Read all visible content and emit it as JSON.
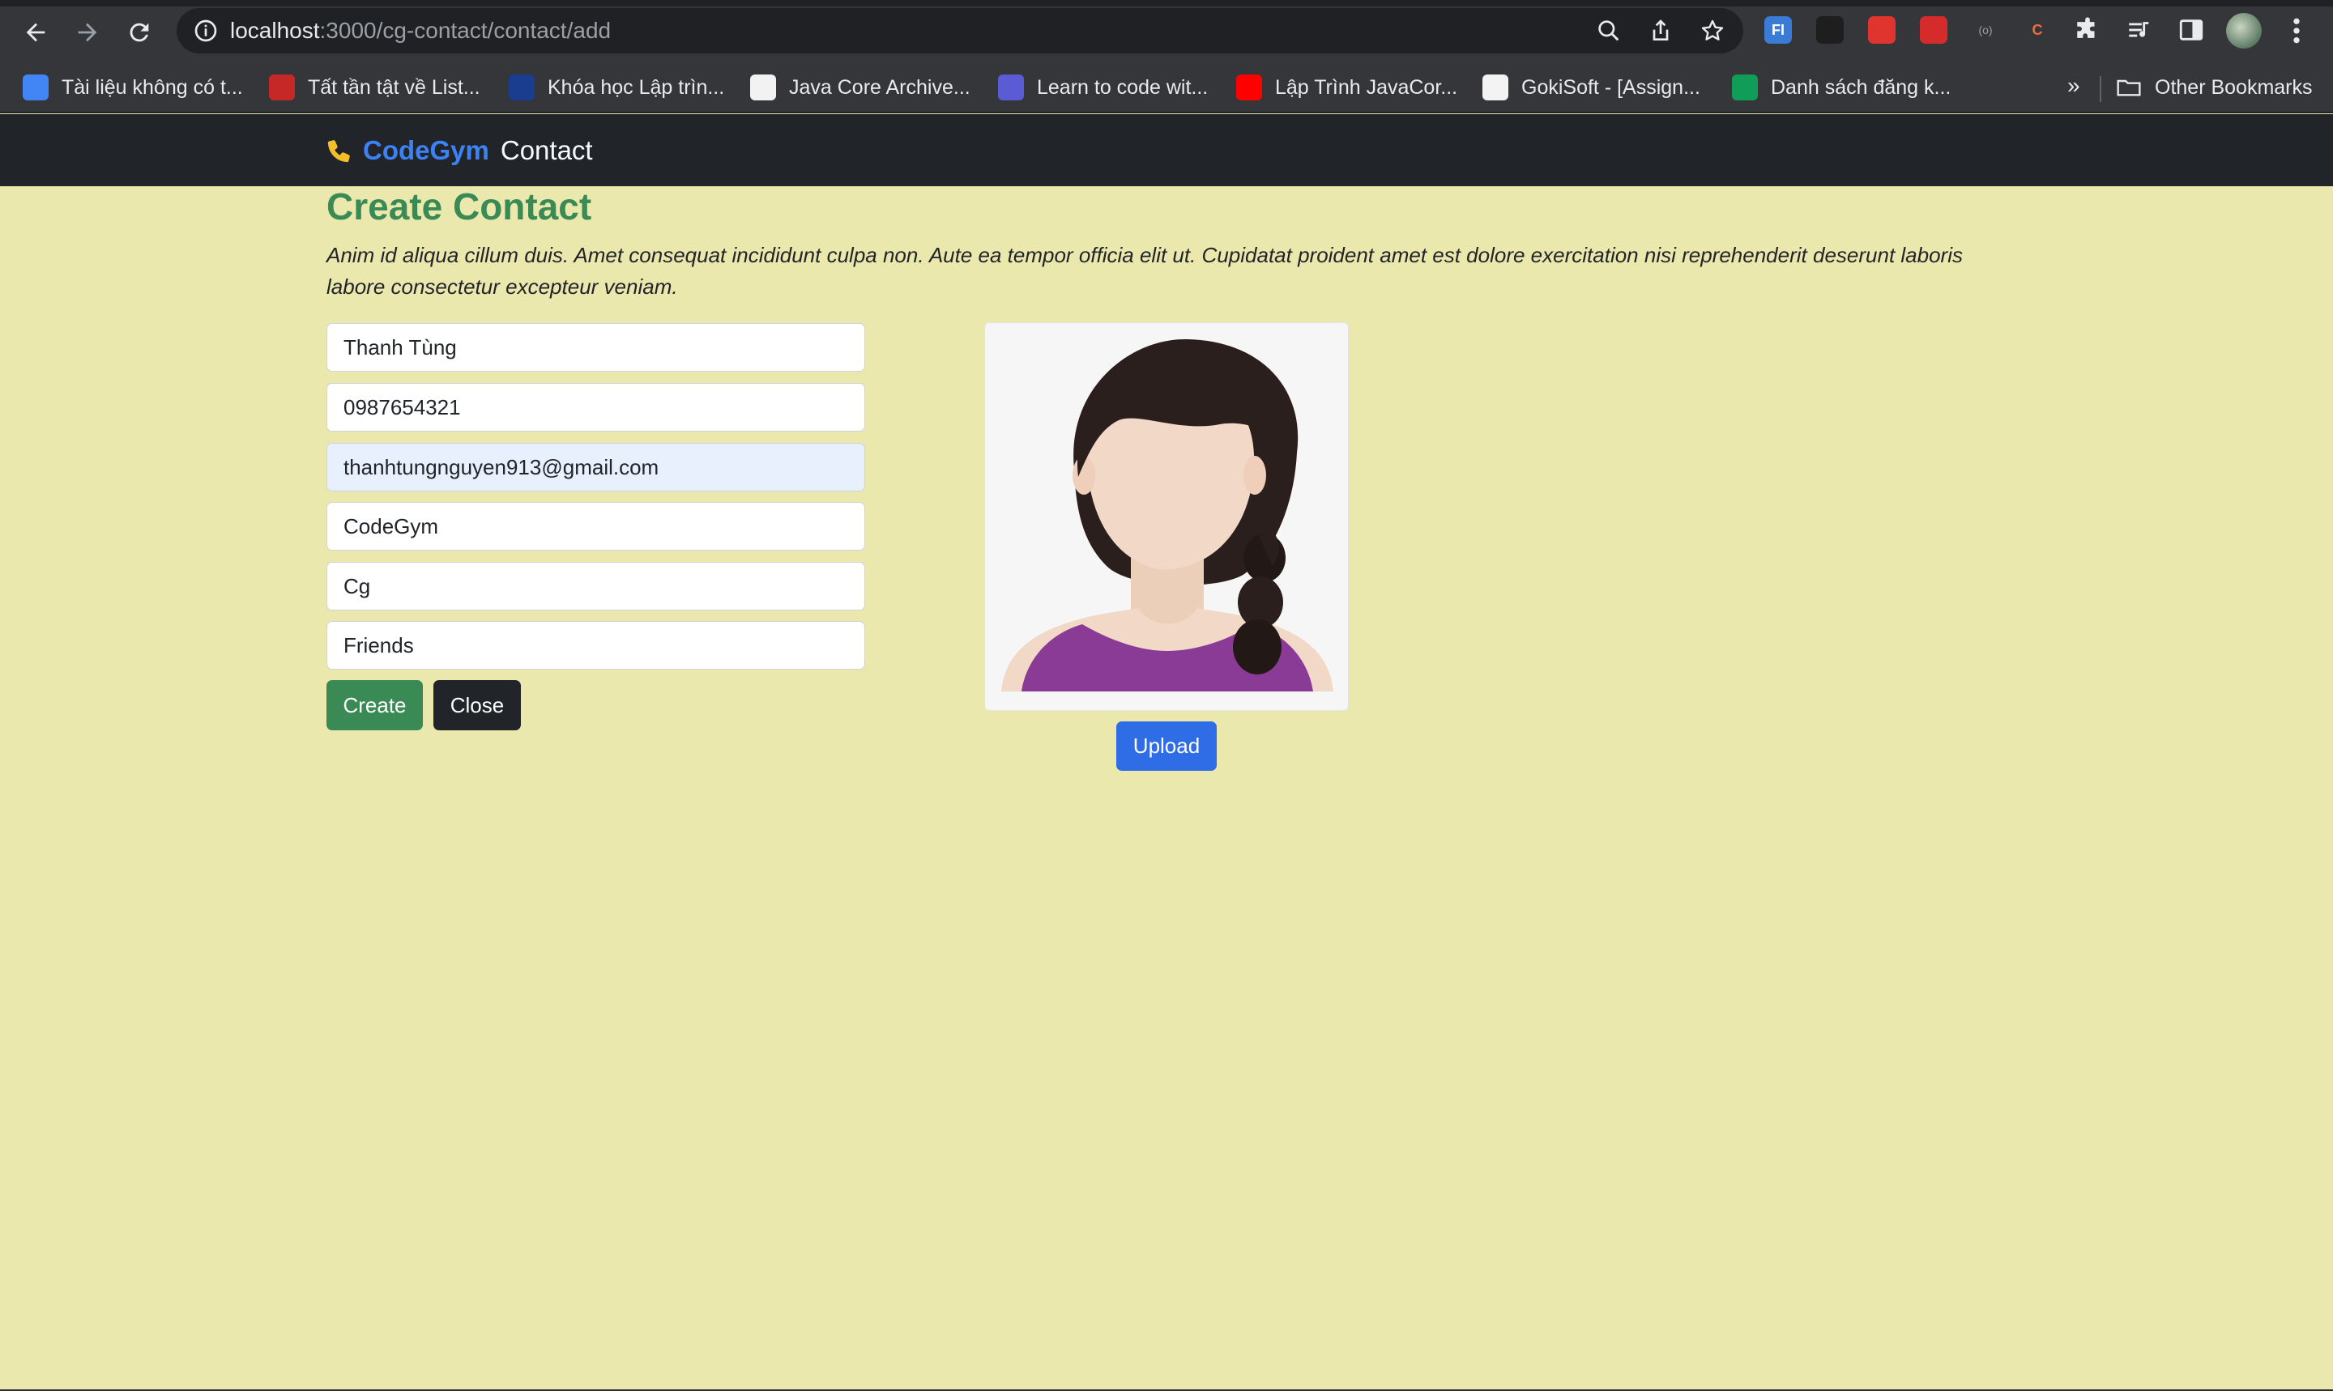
{
  "browser": {
    "url_host": "localhost",
    "url_path": ":3000/cg-contact/contact/add",
    "extensions": [
      {
        "name": "fi-extension-icon",
        "label": "FI",
        "color": "#3a7bd5"
      },
      {
        "name": "extension-2-icon",
        "label": "",
        "color": "#1e1e1e"
      },
      {
        "name": "extension-3-icon",
        "label": "",
        "color": "#e0342f"
      },
      {
        "name": "extension-4-icon",
        "label": "",
        "color": "#d62b2b"
      },
      {
        "name": "extension-5-icon",
        "label": "(o)",
        "color": "#35363a"
      },
      {
        "name": "extension-6-icon",
        "label": "C",
        "color": "#35363a"
      }
    ],
    "bookmarks": [
      {
        "label": "Tài liệu không có t...",
        "icon": "docs-icon",
        "color": "#4285f4"
      },
      {
        "label": "Tất tần tật về List...",
        "icon": "list-icon",
        "color": "#c62828"
      },
      {
        "label": "Khóa học Lập trìn...",
        "icon": "course-icon",
        "color": "#1a3d8f"
      },
      {
        "label": "Java Core Archive...",
        "icon": "java-icon",
        "color": "#f2f2f2"
      },
      {
        "label": "Learn to code wit...",
        "icon": "code-icon",
        "color": "#5b5bd6"
      },
      {
        "label": "Lập Trình JavaCor...",
        "icon": "youtube-icon",
        "color": "#ff0000"
      },
      {
        "label": "GokiSoft - [Assign...",
        "icon": "gokisoft-icon",
        "color": "#f3f3f3"
      },
      {
        "label": "Danh sách đăng k...",
        "icon": "sheets-icon",
        "color": "#0f9d58"
      }
    ],
    "more_bookmarks": "»",
    "other_bookmarks": "Other Bookmarks"
  },
  "navbar": {
    "brand": "CodeGym",
    "subtitle": "Contact",
    "brand_color": "#3d82f5",
    "phone_icon": "phone-icon"
  },
  "page": {
    "title": "Create Contact",
    "description": "Anim id aliqua cillum duis. Amet consequat incididunt culpa non. Aute ea tempor officia elit ut. Cupidatat proident amet est dolore exercitation nisi reprehenderit deserunt laboris labore consectetur excepteur veniam."
  },
  "form": {
    "name": "Thanh Tùng",
    "phone": "0987654321",
    "email": "thanhtungnguyen913@gmail.com",
    "company": "CodeGym",
    "short_name": "Cg",
    "group": "Friends",
    "create_label": "Create",
    "close_label": "Close"
  },
  "avatar": {
    "upload_label": "Upload"
  },
  "colors": {
    "page_bg": "#ebe8ae",
    "title": "#3a8a55",
    "create_btn": "#3a8a55",
    "close_btn": "#212529",
    "upload_btn": "#2f6de6"
  }
}
